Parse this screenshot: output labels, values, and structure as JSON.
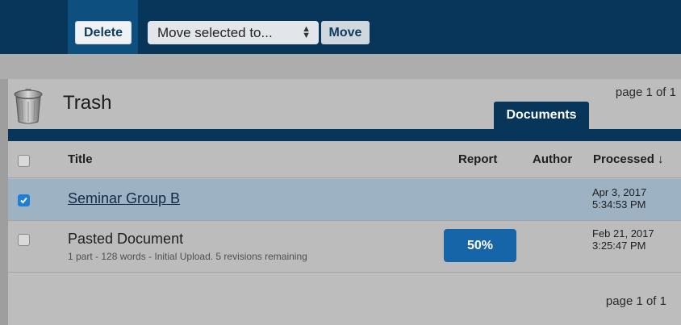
{
  "toolbar": {
    "delete_label": "Delete",
    "move_select_value": "Move selected to...",
    "move_label": "Move"
  },
  "panel": {
    "title": "Trash",
    "page_top": "page 1 of 1",
    "tab_documents": "Documents",
    "page_bottom": "page 1 of 1"
  },
  "table": {
    "headers": {
      "title": "Title",
      "report": "Report",
      "author": "Author",
      "processed": "Processed ↓"
    },
    "rows": [
      {
        "title": "Seminar Group B",
        "checked": true,
        "processed_date": "Apr 3, 2017",
        "processed_time": "5:34:53 PM"
      },
      {
        "title": "Pasted Document",
        "meta": "1 part - 128 words - Initial Upload. 5 revisions remaining",
        "report": "50%",
        "checked": false,
        "processed_date": "Feb 21, 2017",
        "processed_time": "3:25:47 PM"
      }
    ]
  },
  "icons": [
    "trash-can-icon",
    "checkbox-icon",
    "select-arrows-icon",
    "check-icon"
  ],
  "colors": {
    "toolbar_bg": "#07365a",
    "accent": "#1565a8",
    "selected_row": "#9db3c3",
    "checkbox_checked": "#1d7fd8"
  }
}
